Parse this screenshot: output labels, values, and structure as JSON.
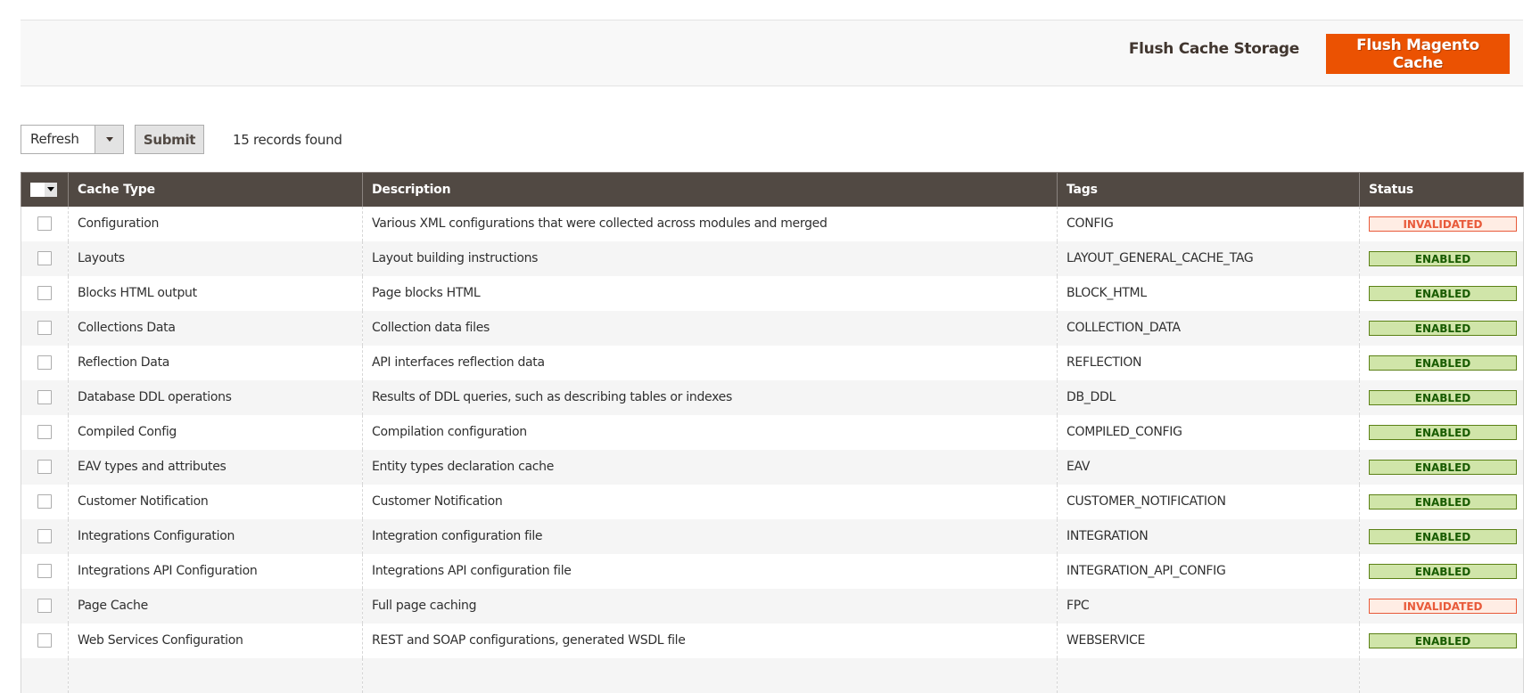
{
  "page_actions": {
    "flush_storage_label": "Flush Cache Storage",
    "flush_magento_label": "Flush Magento Cache",
    "accent_color": "#eb5202"
  },
  "toolbar": {
    "action_select_value": "Refresh",
    "submit_label": "Submit",
    "records_found": "15 records found"
  },
  "grid": {
    "columns": [
      "Cache Type",
      "Description",
      "Tags",
      "Status"
    ],
    "rows": [
      {
        "type": "Configuration",
        "description": "Various XML configurations that were collected across modules and merged",
        "tags": "CONFIG",
        "status": "INVALIDATED"
      },
      {
        "type": "Layouts",
        "description": "Layout building instructions",
        "tags": "LAYOUT_GENERAL_CACHE_TAG",
        "status": "ENABLED"
      },
      {
        "type": "Blocks HTML output",
        "description": "Page blocks HTML",
        "tags": "BLOCK_HTML",
        "status": "ENABLED"
      },
      {
        "type": "Collections Data",
        "description": "Collection data files",
        "tags": "COLLECTION_DATA",
        "status": "ENABLED"
      },
      {
        "type": "Reflection Data",
        "description": "API interfaces reflection data",
        "tags": "REFLECTION",
        "status": "ENABLED"
      },
      {
        "type": "Database DDL operations",
        "description": "Results of DDL queries, such as describing tables or indexes",
        "tags": "DB_DDL",
        "status": "ENABLED"
      },
      {
        "type": "Compiled Config",
        "description": "Compilation configuration",
        "tags": "COMPILED_CONFIG",
        "status": "ENABLED"
      },
      {
        "type": "EAV types and attributes",
        "description": "Entity types declaration cache",
        "tags": "EAV",
        "status": "ENABLED"
      },
      {
        "type": "Customer Notification",
        "description": "Customer Notification",
        "tags": "CUSTOMER_NOTIFICATION",
        "status": "ENABLED"
      },
      {
        "type": "Integrations Configuration",
        "description": "Integration configuration file",
        "tags": "INTEGRATION",
        "status": "ENABLED"
      },
      {
        "type": "Integrations API Configuration",
        "description": "Integrations API configuration file",
        "tags": "INTEGRATION_API_CONFIG",
        "status": "ENABLED"
      },
      {
        "type": "Page Cache",
        "description": "Full page caching",
        "tags": "FPC",
        "status": "INVALIDATED"
      },
      {
        "type": "Web Services Configuration",
        "description": "REST and SOAP configurations, generated WSDL file",
        "tags": "WEBSERVICE",
        "status": "ENABLED"
      },
      {
        "type": "",
        "description": "",
        "tags": "",
        "status": ""
      }
    ]
  }
}
